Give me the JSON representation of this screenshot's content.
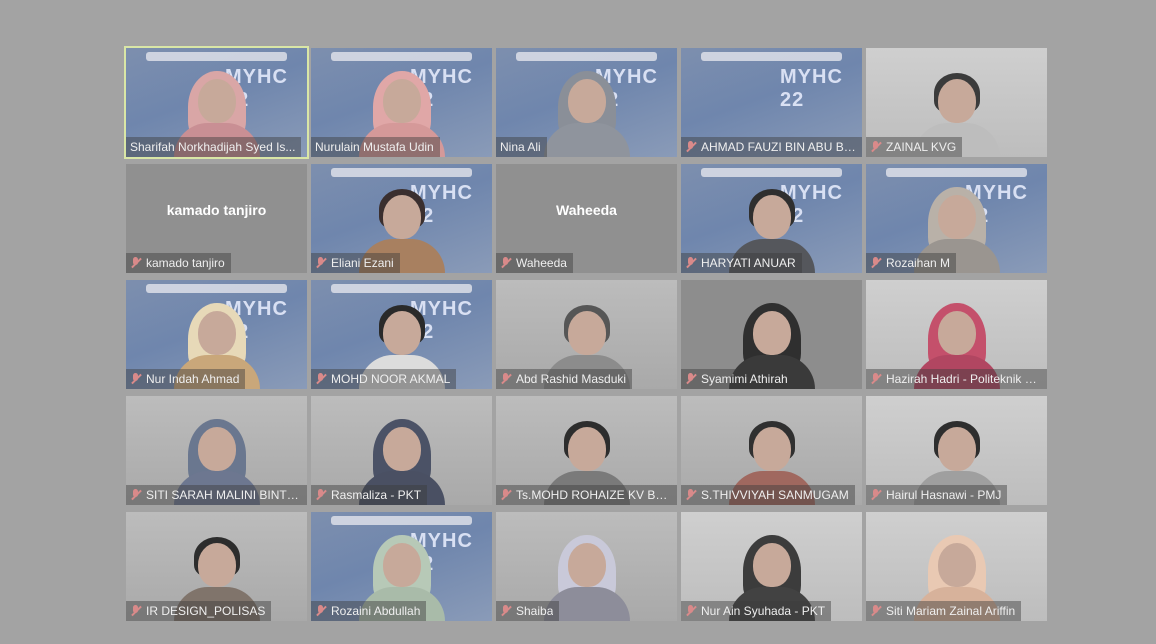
{
  "meeting": {
    "event_logo": "MYHC 22",
    "participants": [
      {
        "name": "Sharifah Norkhadijah Syed Is...",
        "muted": false,
        "active": true,
        "video": "event",
        "hijab": true,
        "hijab_color": "#d9a6a6",
        "body_color": "#c98f94"
      },
      {
        "name": "Nurulain Mustafa Udin",
        "muted": false,
        "active": false,
        "video": "event",
        "hijab": true,
        "hijab_color": "#e0a7a7",
        "body_color": "#d59999"
      },
      {
        "name": "Nina Ali",
        "muted": false,
        "active": false,
        "video": "event",
        "hijab": true,
        "hijab_color": "#8a8f98",
        "body_color": "#8f949d"
      },
      {
        "name": "AHMAD FAUZI BIN ABU BA...",
        "muted": true,
        "active": false,
        "video": "event",
        "hijab": false,
        "person": false
      },
      {
        "name": "ZAINAL KVG",
        "muted": true,
        "active": false,
        "video": "white",
        "hijab": false,
        "hair_color": "#3b3b3b",
        "body_color": "#bdbdbd"
      },
      {
        "name": "kamado tanjiro",
        "display": "kamado tanjiro",
        "muted": true,
        "active": false,
        "video": "none"
      },
      {
        "name": "Eliani Ezani",
        "muted": true,
        "active": false,
        "video": "event",
        "hijab": false,
        "hair_color": "#3a2f2f",
        "body_color": "#a88060"
      },
      {
        "name": "Waheeda",
        "display": "Waheeda",
        "muted": true,
        "active": false,
        "video": "none"
      },
      {
        "name": "HARYATI ANUAR",
        "muted": true,
        "active": false,
        "video": "event",
        "hijab": false,
        "hair_color": "#2f2f2f",
        "body_color": "#55575c"
      },
      {
        "name": "Rozaihan M",
        "muted": true,
        "active": false,
        "video": "event",
        "hijab": true,
        "hijab_color": "#b9b1a8",
        "body_color": "#9a9590"
      },
      {
        "name": "Nur Indah Ahmad",
        "muted": true,
        "active": false,
        "video": "event",
        "hijab": true,
        "hijab_color": "#e7d9b8",
        "body_color": "#c9a77a"
      },
      {
        "name": "MOHD NOOR AKMAL",
        "muted": true,
        "active": false,
        "video": "event",
        "hijab": false,
        "hair_color": "#2a2a2a",
        "body_color": "#dcdcdc"
      },
      {
        "name": "Abd Rashid Masduki",
        "muted": true,
        "active": false,
        "video": "room",
        "hijab": false,
        "hair_color": "#565656",
        "body_color": "#8c8c8c"
      },
      {
        "name": "Syamimi Athirah",
        "muted": true,
        "active": false,
        "video": "dark",
        "hijab": true,
        "hijab_color": "#2f2f2f",
        "body_color": "#3a3a3a"
      },
      {
        "name": "Hazirah Hadri - Politeknik S...",
        "muted": true,
        "active": false,
        "video": "white",
        "hijab": true,
        "hijab_color": "#c4506b",
        "body_color": "#b14661"
      },
      {
        "name": "SITI SARAH MALINI BINTI ...",
        "muted": true,
        "active": false,
        "video": "room",
        "hijab": true,
        "hijab_color": "#6a778f",
        "body_color": "#6d7790"
      },
      {
        "name": "Rasmaliza - PKT",
        "muted": true,
        "active": false,
        "video": "room",
        "hijab": true,
        "hijab_color": "#4b5266",
        "body_color": "#4a5063"
      },
      {
        "name": "Ts.MOHD ROHAIZE KV BAT...",
        "muted": true,
        "active": false,
        "video": "room",
        "hijab": false,
        "hair_color": "#2d2d2d",
        "body_color": "#7a7a7a"
      },
      {
        "name": "S.THIVVIYAH SANMUGAM",
        "muted": true,
        "active": false,
        "video": "room",
        "hijab": false,
        "hair_color": "#303030",
        "body_color": "#a0685f"
      },
      {
        "name": "Hairul Hasnawi - PMJ",
        "muted": true,
        "active": false,
        "video": "white",
        "hijab": false,
        "hair_color": "#2e2e2e",
        "body_color": "#9f9f9f"
      },
      {
        "name": "IR DESIGN_POLISAS",
        "muted": true,
        "active": false,
        "video": "room",
        "hijab": false,
        "hair_color": "#2d2d2d",
        "body_color": "#80746b"
      },
      {
        "name": "Rozaini Abdullah",
        "muted": true,
        "active": false,
        "video": "event",
        "hijab": true,
        "hijab_color": "#b7c9b7",
        "body_color": "#a9bba9"
      },
      {
        "name": "Shaiba",
        "muted": true,
        "active": false,
        "video": "room",
        "hijab": true,
        "hijab_color": "#c9c9d9",
        "body_color": "#8d8d9a"
      },
      {
        "name": "Nur Ain Syuhada - PKT",
        "muted": true,
        "active": false,
        "video": "white",
        "hijab": true,
        "hijab_color": "#3c3c3c",
        "body_color": "#424242"
      },
      {
        "name": "Siti Mariam Zainal Ariffin",
        "muted": true,
        "active": false,
        "video": "white",
        "hijab": true,
        "hijab_color": "#e9c9b3",
        "body_color": "#d7b29b"
      }
    ]
  }
}
